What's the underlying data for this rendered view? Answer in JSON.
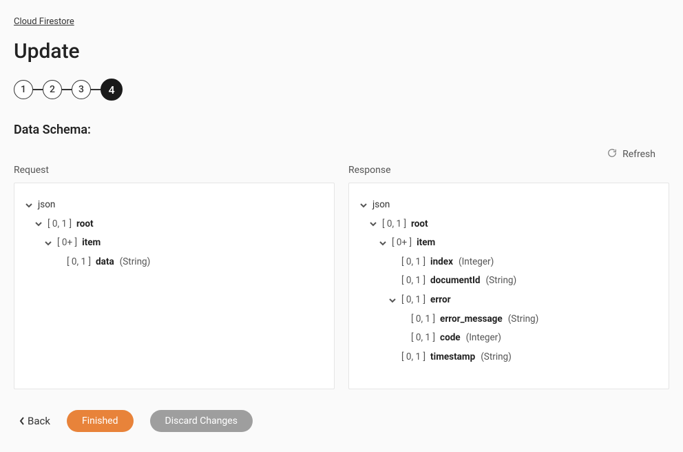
{
  "breadcrumb": {
    "label": "Cloud Firestore"
  },
  "page_title": "Update",
  "stepper": {
    "steps": [
      "1",
      "2",
      "3",
      "4"
    ],
    "active_index": 3
  },
  "section_title": "Data Schema:",
  "refresh_label": "Refresh",
  "request": {
    "label": "Request",
    "root_type": "json",
    "tree": {
      "root": {
        "cardinality": "[ 0, 1 ]",
        "name": "root"
      },
      "item": {
        "cardinality": "[ 0+ ]",
        "name": "item"
      },
      "data": {
        "cardinality": "[ 0, 1 ]",
        "name": "data",
        "type": "(String)"
      }
    }
  },
  "response": {
    "label": "Response",
    "root_type": "json",
    "tree": {
      "root": {
        "cardinality": "[ 0, 1 ]",
        "name": "root"
      },
      "item": {
        "cardinality": "[ 0+ ]",
        "name": "item"
      },
      "index": {
        "cardinality": "[ 0, 1 ]",
        "name": "index",
        "type": "(Integer)"
      },
      "documentId": {
        "cardinality": "[ 0, 1 ]",
        "name": "documentId",
        "type": "(String)"
      },
      "error": {
        "cardinality": "[ 0, 1 ]",
        "name": "error"
      },
      "error_message": {
        "cardinality": "[ 0, 1 ]",
        "name": "error_message",
        "type": "(String)"
      },
      "code": {
        "cardinality": "[ 0, 1 ]",
        "name": "code",
        "type": "(Integer)"
      },
      "timestamp": {
        "cardinality": "[ 0, 1 ]",
        "name": "timestamp",
        "type": "(String)"
      }
    }
  },
  "actions": {
    "back": "Back",
    "finished": "Finished",
    "discard": "Discard Changes"
  }
}
